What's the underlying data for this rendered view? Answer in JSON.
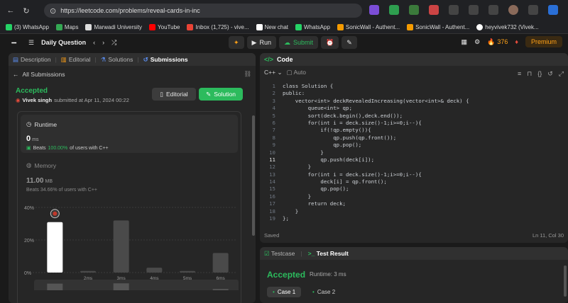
{
  "browser": {
    "url": "https://leetcode.com/problems/reveal-cards-in-increasing-order/submissions/1228802184/?envTyp...",
    "bookmarks": [
      "(3) WhatsApp",
      "Maps",
      "Marwadi University",
      "YouTube",
      "Inbox (1,725) - vive...",
      "New chat",
      "WhatsApp",
      "SonicWall - Authent...",
      "SonicWall - Authent...",
      "heyvivek732 (Vivek..."
    ]
  },
  "nav": {
    "title": "Daily Question",
    "run": "Run",
    "submit": "Submit",
    "streak": "376",
    "premium": "Premium"
  },
  "left": {
    "tabs": [
      "Description",
      "Editorial",
      "Solutions",
      "Submissions"
    ],
    "all_submissions": "All Submissions",
    "status": "Accepted",
    "user": "Vivek singh",
    "submitted": "submitted at Apr 11, 2024 00:22",
    "editorial_btn": "Editorial",
    "solution_btn": "Solution",
    "runtime_label": "Runtime",
    "runtime_value": "0",
    "runtime_unit": "ms",
    "beats_word": "Beats",
    "runtime_beats": "100.00%",
    "beats_suffix": "of users with C++",
    "memory_label": "Memory",
    "memory_value": "11.00",
    "memory_unit": "MB",
    "memory_beats": "Beats 34.66% of users with C++"
  },
  "chart_data": {
    "type": "bar",
    "categories": [
      "0ms",
      "2ms",
      "3ms",
      "4ms",
      "5ms",
      "6ms"
    ],
    "values": [
      31,
      1,
      32,
      3,
      1,
      12
    ],
    "ylim": [
      0,
      40
    ],
    "yticks": [
      "40%",
      "20%",
      "0%"
    ],
    "xtick_labels": [
      "2ms",
      "3ms",
      "4ms",
      "5ms",
      "6ms"
    ],
    "highlight_index": 0
  },
  "code": {
    "header": "Code",
    "language": "C++",
    "auto": "Auto",
    "lines": [
      "class Solution {",
      "public:",
      "    vector<int> deckRevealedIncreasing(vector<int>& deck) {",
      "        queue<int> qp;",
      "        sort(deck.begin(),deck.end());",
      "        for(int i = deck.size()-1;i>=0;i--){",
      "            if(!qp.empty()){",
      "                qp.push(qp.front());",
      "                qp.pop();",
      "            }",
      "            qp.push(deck[i]);",
      "        }",
      "        for(int i = deck.size()-1;i>=0;i--){",
      "            deck[i] = qp.front();",
      "            qp.pop();",
      "        }",
      "        return deck;",
      "    }",
      "};"
    ],
    "current_line": 11,
    "saved": "Saved",
    "position": "Ln 11, Col 30"
  },
  "result": {
    "tab_testcase": "Testcase",
    "tab_result": "Test Result",
    "status": "Accepted",
    "runtime": "Runtime: 3 ms",
    "case1": "Case 1",
    "case2": "Case 2"
  },
  "colors": {
    "accent_green": "#2cbb5d",
    "accent_orange": "#ffa116",
    "bar": "#4a4a4a",
    "bar_highlight": "#ffffff"
  }
}
